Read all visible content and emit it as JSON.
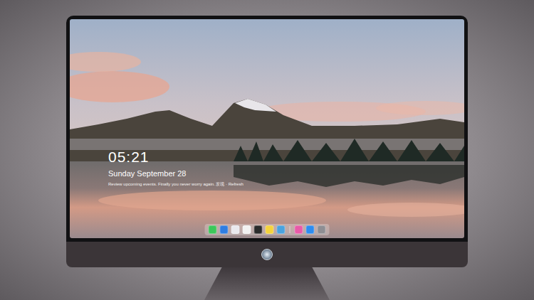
{
  "lock_screen": {
    "time": "05:21",
    "date": "Sunday September 28",
    "message": "Review upcoming events. Finally you never worry again. 发现 · Refresh"
  },
  "dock": {
    "apps": [
      {
        "color": "#3cc75a"
      },
      {
        "color": "#2f7de1"
      },
      {
        "color": "#e9e9ee"
      },
      {
        "color": "#f2f2f2"
      },
      {
        "color": "#2b2b2b"
      },
      {
        "color": "#f5d33c"
      },
      {
        "color": "#4aa3df"
      },
      {
        "color": "#e85aa8"
      },
      {
        "color": "#2d8cf0"
      },
      {
        "color": "#8e8e93"
      }
    ]
  }
}
